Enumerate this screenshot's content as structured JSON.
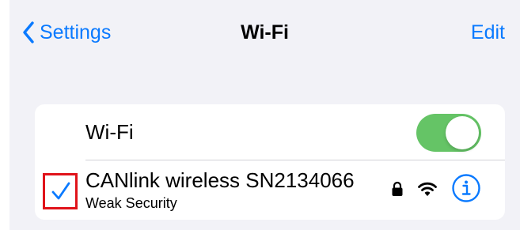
{
  "nav": {
    "back_label": "Settings",
    "title": "Wi-Fi",
    "edit_label": "Edit"
  },
  "wifi_row": {
    "label": "Wi-Fi",
    "toggle_on": true
  },
  "network": {
    "name": "CANlink wireless SN2134066",
    "subtitle": "Weak Security",
    "connected": true,
    "secured": true
  },
  "icons": {
    "back": "chevron-left-icon",
    "check": "checkmark-icon",
    "lock": "lock-icon",
    "wifi": "wifi-signal-icon",
    "info": "info-icon"
  },
  "colors": {
    "accent": "#0a7aff",
    "toggle_on": "#65c466",
    "highlight_box": "#e0131a",
    "background": "#f2f2f7"
  }
}
